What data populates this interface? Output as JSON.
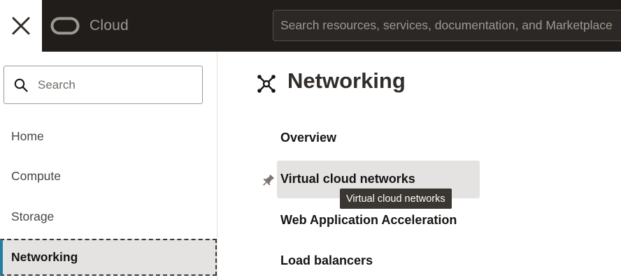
{
  "topbar": {
    "brand_text": "Cloud",
    "search_placeholder": "Search resources, services, documentation, and Marketplace"
  },
  "sidebar": {
    "search_placeholder": "Search",
    "items": [
      {
        "label": "Home"
      },
      {
        "label": "Compute"
      },
      {
        "label": "Storage"
      },
      {
        "label": "Networking",
        "active": true
      }
    ]
  },
  "main": {
    "title": "Networking",
    "links": [
      {
        "label": "Overview"
      },
      {
        "label": "Virtual cloud networks",
        "hovered": true
      },
      {
        "label": "Web Application Acceleration"
      },
      {
        "label": "Load balancers"
      }
    ],
    "tooltip": "Virtual cloud networks"
  },
  "colors": {
    "topbar_bg": "#201d1b",
    "active_indicator": "#227e9e",
    "highlight_bg": "#e4e3e1"
  },
  "icons": [
    "close-icon",
    "cloud-logo-icon",
    "search-icon",
    "networking-icon",
    "pin-icon"
  ]
}
